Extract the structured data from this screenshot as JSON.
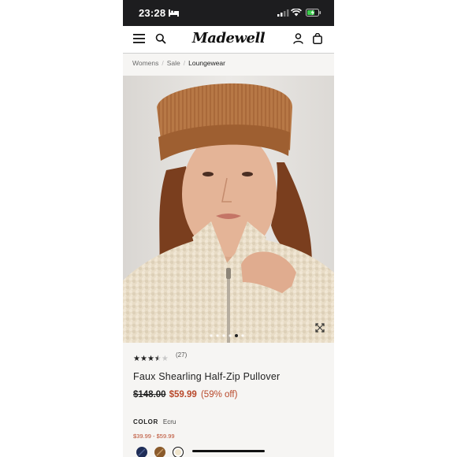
{
  "status_bar": {
    "time": "23:28"
  },
  "header": {
    "brand": "Madewell"
  },
  "breadcrumb": [
    "Womens",
    "Sale",
    "Loungewear"
  ],
  "product": {
    "rating": 3.5,
    "rating_max": 5,
    "review_count": "(27)",
    "title": "Faux Shearling Half-Zip Pullover",
    "price_original": "$148.00",
    "price_sale": "$59.99",
    "price_discount": "(59% off)",
    "color_label": "COLOR",
    "color_value": "Ecru",
    "price_range": "$39.99 - $59.99"
  },
  "carousel": {
    "total": 6,
    "active": 5
  },
  "swatches": [
    {
      "name": "navy",
      "color": "#1f2d57"
    },
    {
      "name": "brown",
      "color": "#8a5a2b"
    },
    {
      "name": "ecru",
      "color": "#efe4cc",
      "selected": true
    }
  ],
  "colors": {
    "accent_sale": "#b8482a",
    "status_bar_bg": "#1d1d1f"
  }
}
